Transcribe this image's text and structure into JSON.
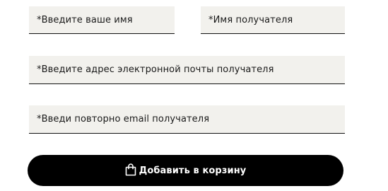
{
  "form": {
    "sender_name": {
      "placeholder": "*Введите ваше имя",
      "value": ""
    },
    "recipient_name": {
      "placeholder": "*Имя получателя",
      "value": ""
    },
    "recipient_email": {
      "placeholder": "*Введите адрес электронной почты получателя",
      "value": ""
    },
    "recipient_email_confirm": {
      "placeholder": "*Введи повторно email получателя",
      "value": ""
    }
  },
  "cart_button": {
    "label": "Добавить в корзину",
    "icon": "shopping-bag-icon"
  },
  "colors": {
    "field_background": "#f2f1ed",
    "field_underline": "#111111",
    "button_background": "#000000",
    "button_text": "#ffffff"
  }
}
